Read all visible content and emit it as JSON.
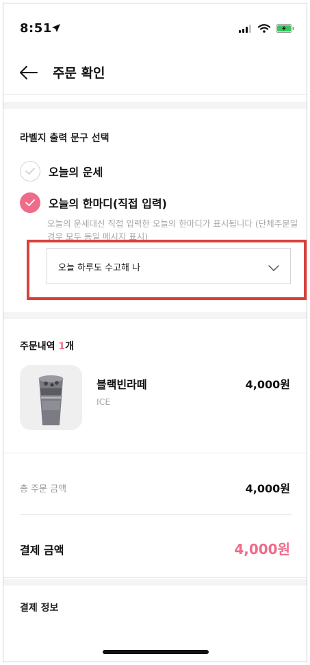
{
  "status_bar": {
    "time": "8:51"
  },
  "header": {
    "title": "주문 확인"
  },
  "label_section": {
    "title": "라벨지 출력 문구 선택",
    "options": [
      {
        "label": "오늘의 운세",
        "selected": false
      },
      {
        "label": "오늘의 한마디(직접 입력)",
        "selected": true
      }
    ],
    "description": "오늘의 운세대신 직접 입력한 오늘의 한마디가 표시됩니다 (단체주문일 경우 모두 동일 메시지 표시)",
    "dropdown_value": "오늘 하루도 수고해 나"
  },
  "order": {
    "title_prefix": "주문내역 ",
    "count": "1",
    "count_suffix": "개",
    "items": [
      {
        "name": "블랙빈라떼",
        "option": "ICE",
        "price": "4,000원"
      }
    ]
  },
  "summary": {
    "total_label": "총 주문 금액",
    "total_value": "4,000원",
    "pay_label": "결제 금액",
    "pay_value": "4,000원"
  },
  "payment_info": {
    "title": "결제 정보"
  },
  "colors": {
    "accent": "#ef6b8a",
    "highlight_border": "#d9403a"
  }
}
